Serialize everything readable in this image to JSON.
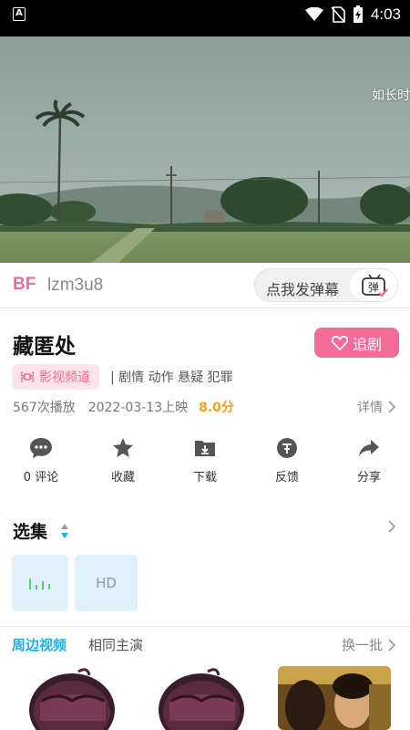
{
  "status_bar": {
    "app_icon_letter": "A",
    "time": "4:03"
  },
  "video": {
    "danmaku_text": "如长时"
  },
  "danmaku_bar": {
    "logo": "BF",
    "code": "lzm3u8",
    "send_placeholder": "点我发弹幕",
    "toggle_label": "弹"
  },
  "info": {
    "title": "藏匿处",
    "follow_label": "追剧",
    "channel_tag": "影视频道",
    "genres": "| 剧情 动作 悬疑 犯罪",
    "plays": "567次播放",
    "release": "2022-03-13上映",
    "score": "8.0分",
    "detail_label": "详情"
  },
  "actions": [
    {
      "label": "0 评论",
      "icon": "comment-icon"
    },
    {
      "label": "收藏",
      "icon": "star-icon"
    },
    {
      "label": "下载",
      "icon": "download-icon"
    },
    {
      "label": "反馈",
      "icon": "feedback-icon"
    },
    {
      "label": "分享",
      "icon": "share-icon"
    }
  ],
  "episodes": {
    "title": "选集",
    "items": [
      {
        "label": "",
        "state": "playing"
      },
      {
        "label": "HD"
      }
    ]
  },
  "related": {
    "tabs": [
      "周边视频",
      "相同主演"
    ],
    "refresh_label": "换一批"
  },
  "colors": {
    "accent_pink": "#f46d98",
    "accent_blue": "#22aee6",
    "score_orange": "#f0a020"
  }
}
